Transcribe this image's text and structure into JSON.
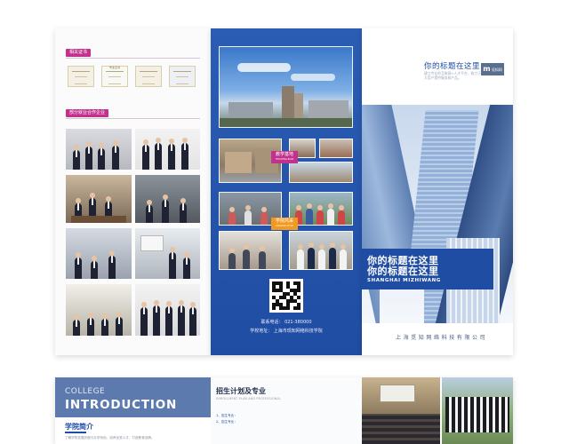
{
  "left_panel": {
    "tag_certs": "相关证书",
    "tag_partners": "部分就业合作企业",
    "certificates": [
      {
        "label": "",
        "name": "cert-1"
      },
      {
        "label": "毕业证书",
        "name": "cert-2"
      },
      {
        "label": "",
        "name": "cert-3"
      },
      {
        "label": "",
        "name": "cert-4"
      }
    ]
  },
  "middle_panel": {
    "badge_teaching": "教学基地",
    "badge_teaching_en": "TEACHING BASE",
    "badge_style": "学院风采",
    "badge_style_en": "COLLEGE STYLE",
    "phone": "联系电话： 021-380000",
    "address": "学校地址： 上海市现知网络科技学院"
  },
  "right_panel": {
    "title": "你的标题在这里",
    "subtitle": "建立专业的互联网+人才平台，致力于广大用户提供服务和产品。",
    "logo_letter": "m",
    "logo_text": "觅知网",
    "headline_1": "你的标题在这里",
    "headline_2": "你的标题在这里",
    "headline_en": "SHANGHAI MIZHIWANG",
    "company": "上海觅知网络科技有限公司"
  },
  "bottom_brochure": {
    "college": "COLLEGE",
    "introduction": "INTRODUCTION",
    "section_title": "学院简介",
    "section_body": "了解学院发展历程与办学特色，培养优秀人才，打造教育品牌。",
    "enroll_title": "招生计划及专业",
    "enroll_en": "ENROLLMENT PLAN AND PROFESSIONAL",
    "enroll_items": [
      "1、招生专业：",
      "2、招生专业："
    ]
  },
  "colors": {
    "brand_blue": "#1f4da3",
    "accent_magenta": "#c2318c",
    "accent_orange": "#f29a1f"
  }
}
